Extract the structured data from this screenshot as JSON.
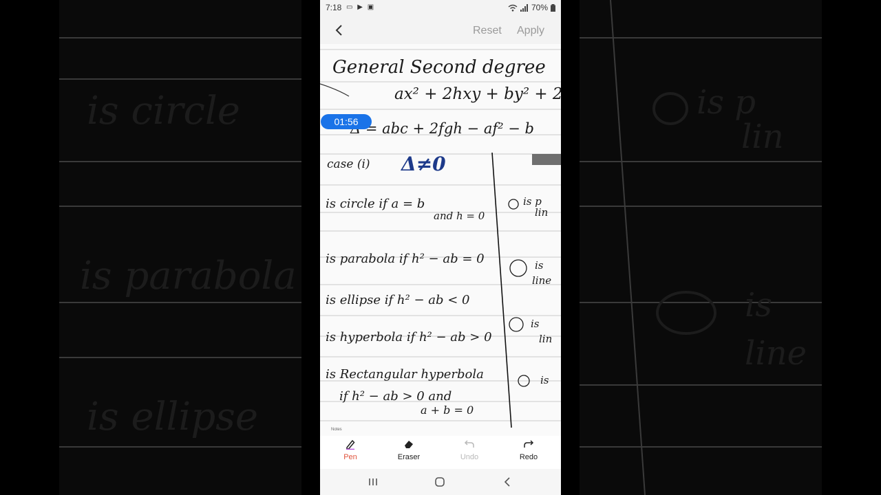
{
  "status": {
    "time": "7:18",
    "battery": "70%"
  },
  "editor": {
    "reset_label": "Reset",
    "apply_label": "Apply"
  },
  "timer": "01:56",
  "notes": {
    "title_line": "General Second degree",
    "equation_line": "ax² + 2hxy + by² + 2",
    "delta_line": "Δ = abc + 2fgh − af² − b",
    "case_line": "case (i)",
    "case_condition": "Δ≠0",
    "circle_line": "is circle if  a = b",
    "circle_cond": "and h = 0",
    "parabola_line": "is parabola if h² − ab = 0",
    "ellipse_line": "is ellipse if h² − ab < 0",
    "hyperbola_line": "is hyperbola if h² − ab > 0",
    "rect_line": "is Rectangular hyperbola",
    "rect_cond_1": "if  h² − ab > 0  and",
    "rect_cond_2": "a + b = 0",
    "right_col_1": "is p",
    "right_col_1b": "lin",
    "right_col_2": "is",
    "right_col_2b": "line",
    "right_col_3": "is",
    "right_col_3b": "lin",
    "right_col_4": "is",
    "footer": "Notes"
  },
  "tools": {
    "pen": "Pen",
    "eraser": "Eraser",
    "undo": "Undo",
    "redo": "Redo"
  },
  "background": {
    "left_lines": [
      "is circle",
      "is parabola",
      "is ellipse"
    ],
    "right_lines": [
      "is p",
      "lin",
      "is",
      "line"
    ]
  },
  "colors": {
    "accent": "#1a73e8",
    "pen_active": "#e0533c",
    "ink": "#1b1b1b",
    "ink_blue": "#1d3a8a"
  }
}
